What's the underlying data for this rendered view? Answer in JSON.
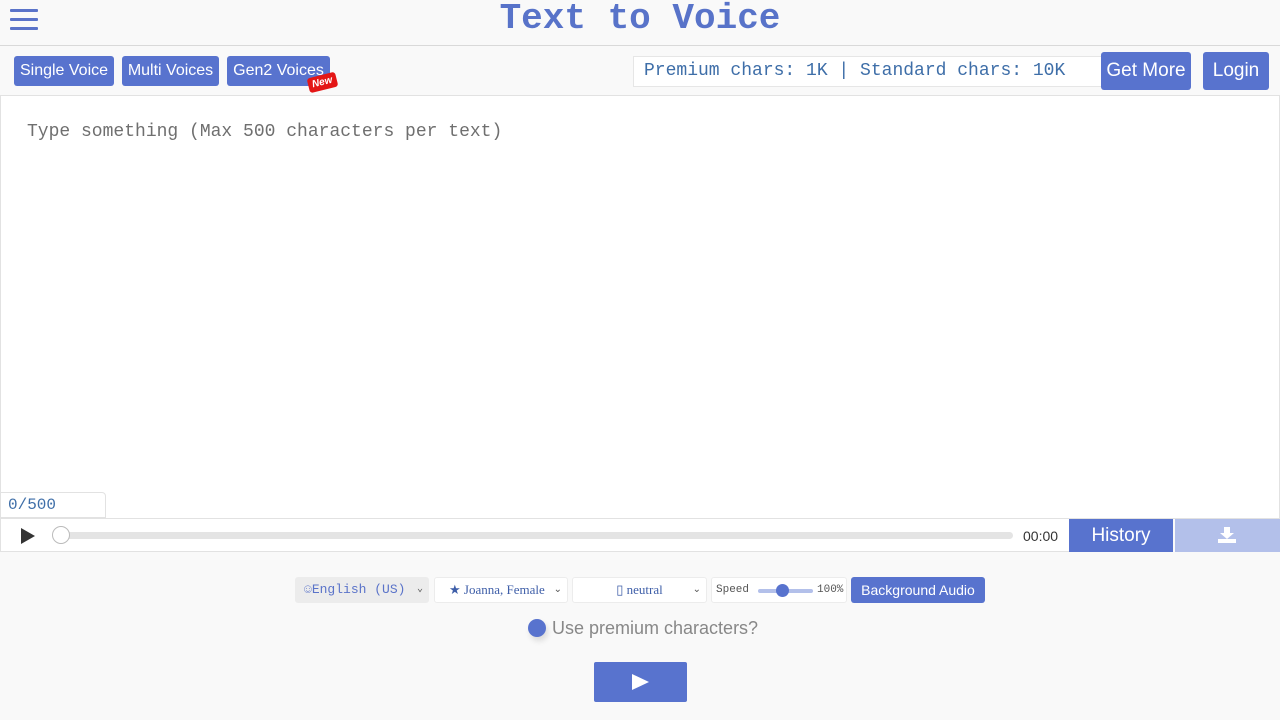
{
  "header": {
    "title": "Text to Voice",
    "menu_icon": "hamburger-menu-icon"
  },
  "nav": {
    "tabs": [
      {
        "label": "Single Voice"
      },
      {
        "label": "Multi Voices"
      },
      {
        "label": "Gen2 Voices",
        "badge": "New"
      }
    ],
    "chars_info": "Premium chars: 1K | Standard chars: 10K",
    "get_more_label": "Get More",
    "login_label": "Login"
  },
  "editor": {
    "placeholder": "Type something (Max 500 characters per text)",
    "value": "",
    "counter": "0/500"
  },
  "player": {
    "play_icon": "play-icon",
    "progress": 0,
    "time": "00:00",
    "history_label": "History",
    "download_icon": "download-icon"
  },
  "controls": {
    "language": {
      "icon": "smiley-icon",
      "icon_glyph": "☺",
      "selected": "English (US)"
    },
    "voice": {
      "icon": "star-icon",
      "icon_glyph": "★",
      "selected": "Joanna, Female"
    },
    "style": {
      "icon_glyph": "▯",
      "selected": "neutral"
    },
    "speed": {
      "label": "Speed",
      "value_text": "100%",
      "value_percent": 100
    },
    "background_audio_label": "Background Audio",
    "premium_question": "Use premium characters?",
    "premium_checked": true
  },
  "colors": {
    "accent": "#5873ce",
    "accent_light": "#b3c0ea",
    "new_badge": "#e41616",
    "mono_text": "#3e6ea8"
  }
}
